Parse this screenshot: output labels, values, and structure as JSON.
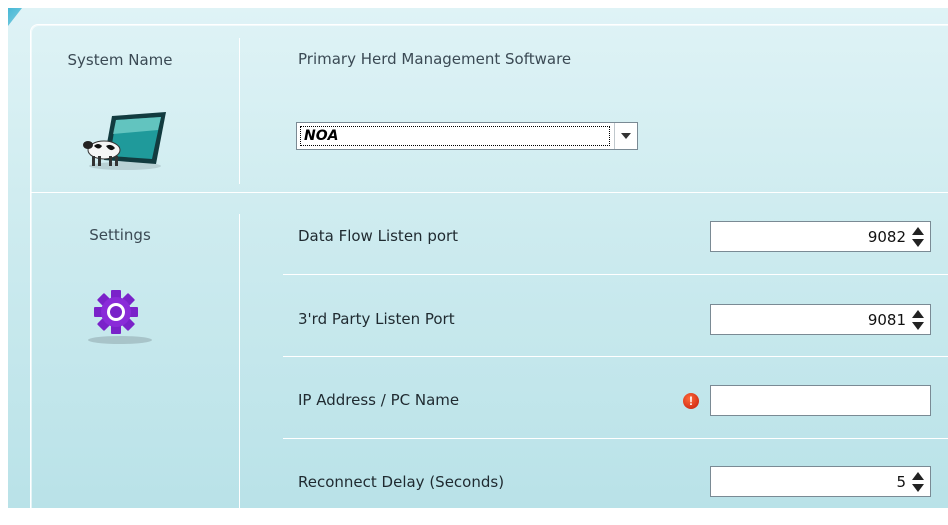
{
  "left_column": {
    "system_name_label": "System Name",
    "settings_label": "Settings",
    "system_icon": "cow-monitor-icon",
    "settings_icon": "gear-icon"
  },
  "system_section": {
    "primary_label": "Primary Herd Management Software",
    "selected_software": "NOA"
  },
  "settings_section": {
    "data_flow_label": "Data Flow Listen port",
    "data_flow_value": "9082",
    "third_party_label": "3'rd Party Listen Port",
    "third_party_value": "9081",
    "ip_label": "IP Address / PC Name",
    "ip_value": "",
    "ip_status_icon": "error-icon",
    "ip_status_glyph": "!",
    "reconnect_label": "Reconnect Delay (Seconds)",
    "reconnect_value": "5"
  },
  "colors": {
    "panel_gradient_top": "#dff3f6",
    "panel_gradient_bottom": "#b9e2e8",
    "gear_purple": "#7a22c9",
    "error_red": "#c41a0a"
  }
}
